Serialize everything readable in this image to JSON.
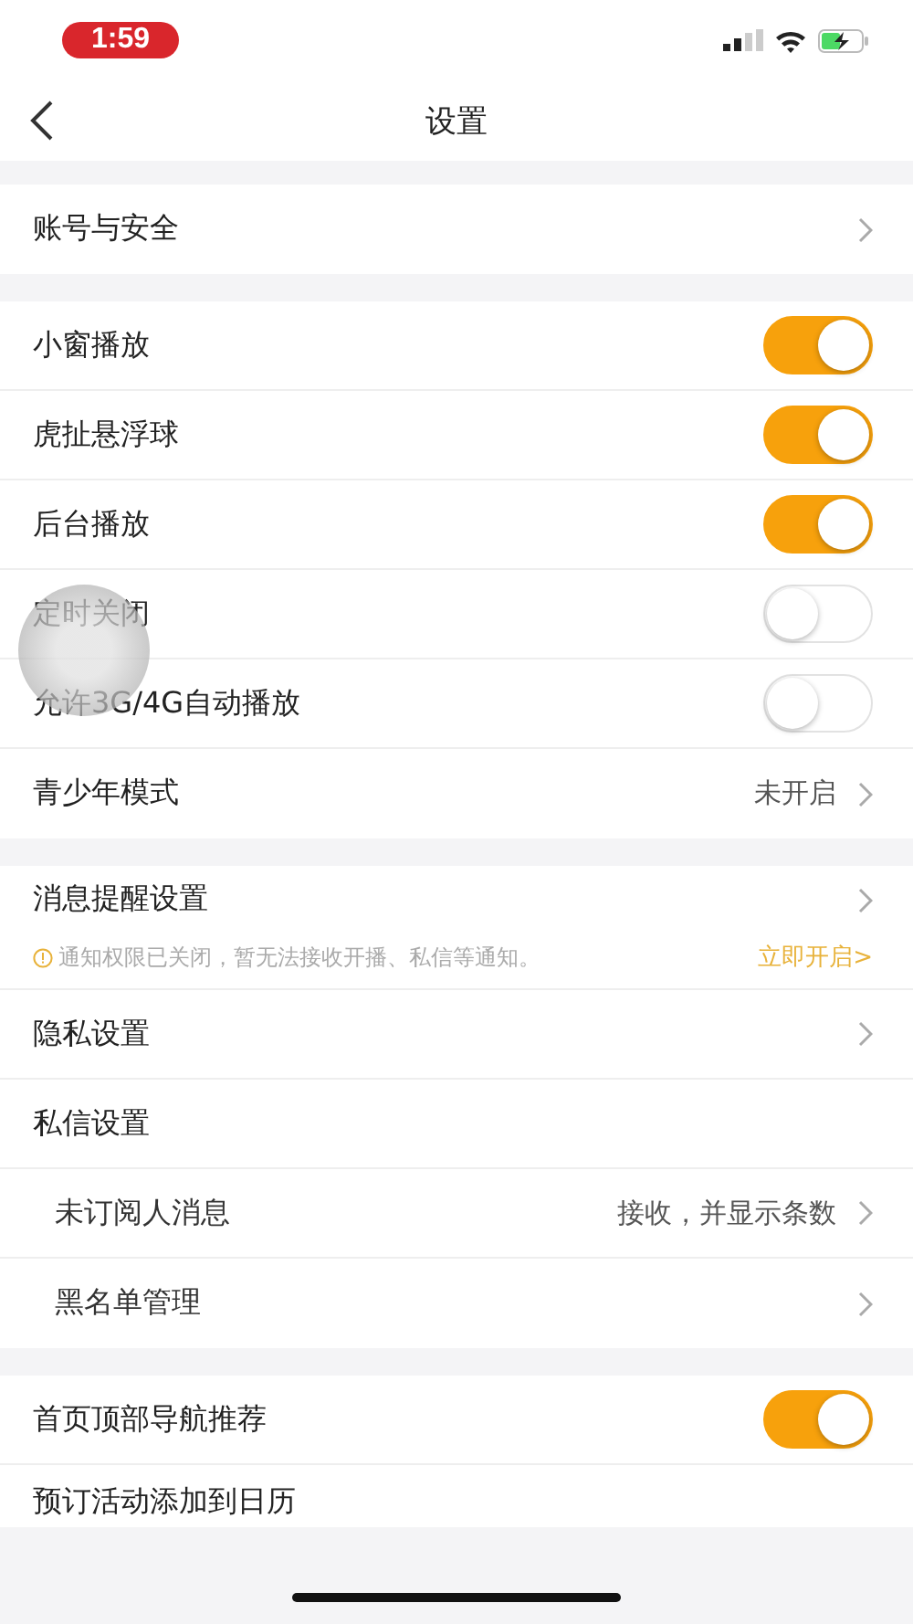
{
  "status_bar": {
    "time": "1:59"
  },
  "nav": {
    "title": "设置"
  },
  "sections": [
    {
      "items": [
        {
          "kind": "link",
          "label": "账号与安全"
        }
      ]
    },
    {
      "items": [
        {
          "kind": "toggle",
          "label": "小窗播放",
          "on": true
        },
        {
          "kind": "toggle",
          "label": "虎扯悬浮球",
          "on": true
        },
        {
          "kind": "toggle",
          "label": "后台播放",
          "on": true
        },
        {
          "kind": "toggle",
          "label": "定时关闭",
          "on": false
        },
        {
          "kind": "toggle",
          "label": "允许3G/4G自动播放",
          "on": false
        },
        {
          "kind": "link",
          "label": "青少年模式",
          "value": "未开启"
        }
      ]
    },
    {
      "items": [
        {
          "kind": "link",
          "label": "消息提醒设置",
          "notice": {
            "text": "通知权限已关闭，暂无法接收开播、私信等通知。",
            "action": "立即开启>"
          }
        },
        {
          "kind": "link",
          "label": "隐私设置"
        },
        {
          "kind": "header",
          "label": "私信设置"
        },
        {
          "kind": "sub",
          "label": "未订阅人消息",
          "value": "接收，并显示条数"
        },
        {
          "kind": "sub",
          "label": "黑名单管理"
        }
      ]
    },
    {
      "items": [
        {
          "kind": "toggle",
          "label": "首页顶部导航推荐",
          "on": true
        },
        {
          "kind": "plain",
          "label": "预订活动添加到日历"
        }
      ]
    }
  ]
}
